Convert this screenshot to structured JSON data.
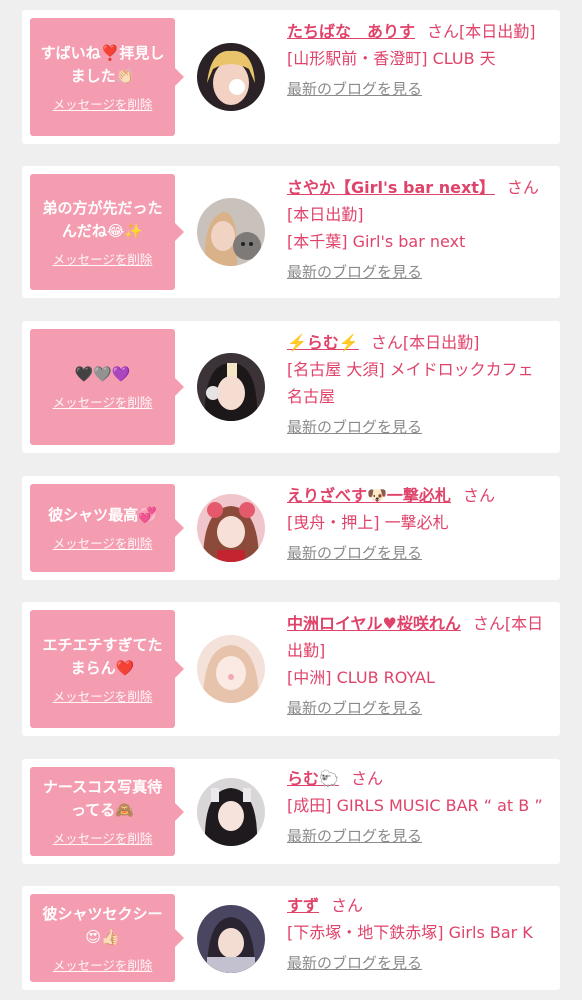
{
  "delete_label": "メッセージを削除",
  "honorific": "さん",
  "more_label": "最新のブログを見る",
  "items": [
    {
      "message": "すばいね❣️拝見しました👏🏻",
      "name": "たちばな　ありす",
      "after_name": "[本日出勤]",
      "shop": "[山形駅前・香澄町] CLUB 天"
    },
    {
      "message": "弟の方が先だったんだね😂✨",
      "name": "さやか【Girl's bar next】",
      "after_name": "[本日出勤]",
      "shop": "[本千葉] Girl's bar next"
    },
    {
      "message": "🖤🩶💜",
      "name": "⚡️らむ⚡️",
      "after_name": "[本日出勤]",
      "shop": "[名古屋 大須] メイドロックカフェ名古屋"
    },
    {
      "message": "彼シャツ最高💞",
      "name": "えりざべす🐶一撃必札",
      "after_name": "",
      "shop": "[曳舟・押上] 一撃必札"
    },
    {
      "message": "エチエチすぎてたまらん❤️",
      "name": "中洲ロイヤル♥桜咲れん",
      "after_name": "[本日出勤]",
      "shop": "[中洲] CLUB ROYAL"
    },
    {
      "message": "ナースコス写真待ってる🙈",
      "name": "らむ🐑",
      "after_name": "",
      "shop": "[成田] GIRLS MUSIC BAR “ at B ”"
    },
    {
      "message": "彼シャツセクシー😍👍🏻",
      "name": "すず",
      "after_name": "",
      "shop": "[下赤塚・地下鉄赤塚] Girls Bar K"
    }
  ],
  "colors": {
    "background": "#efefef",
    "card": "#ffffff",
    "bubble": "#f59db0",
    "name_text": "#e0436a",
    "link_gray": "#8a8a8a"
  }
}
